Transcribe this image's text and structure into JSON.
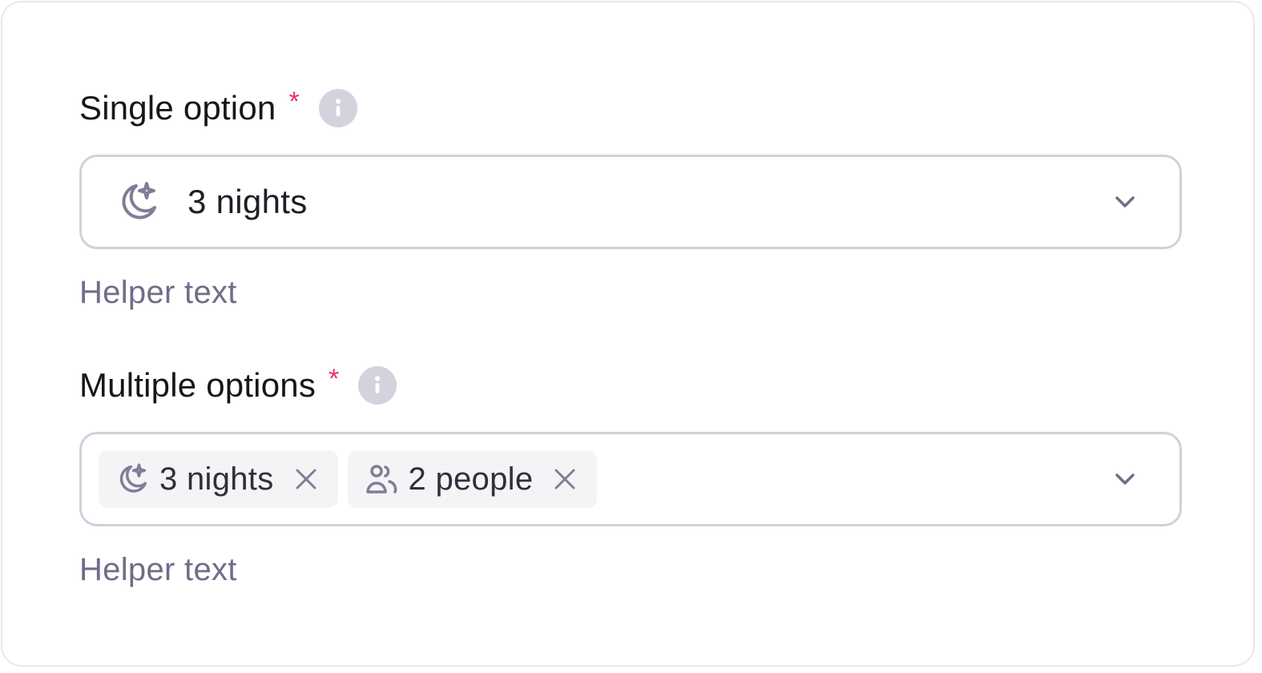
{
  "fields": [
    {
      "label": "Single option",
      "required_mark": "*",
      "info_icon": "info-icon",
      "value_icon": "moon-stars-icon",
      "value": "3 nights",
      "dropdown_icon": "chevron-down-icon",
      "helper_text": "Helper text"
    },
    {
      "label": "Multiple options",
      "required_mark": "*",
      "info_icon": "info-icon",
      "chips": [
        {
          "icon": "moon-stars-icon",
          "label": "3 nights",
          "remove_icon": "close-icon"
        },
        {
          "icon": "users-icon",
          "label": "2 people",
          "remove_icon": "close-icon"
        }
      ],
      "dropdown_icon": "chevron-down-icon",
      "helper_text": "Helper text"
    }
  ],
  "colors": {
    "label": "#16161c",
    "required": "#e5336b",
    "info_bg": "#d3d3de",
    "border": "#d1d1dc",
    "icon": "#7e7e98",
    "helper": "#6e6e8a",
    "chip_bg": "#f4f4f6"
  }
}
